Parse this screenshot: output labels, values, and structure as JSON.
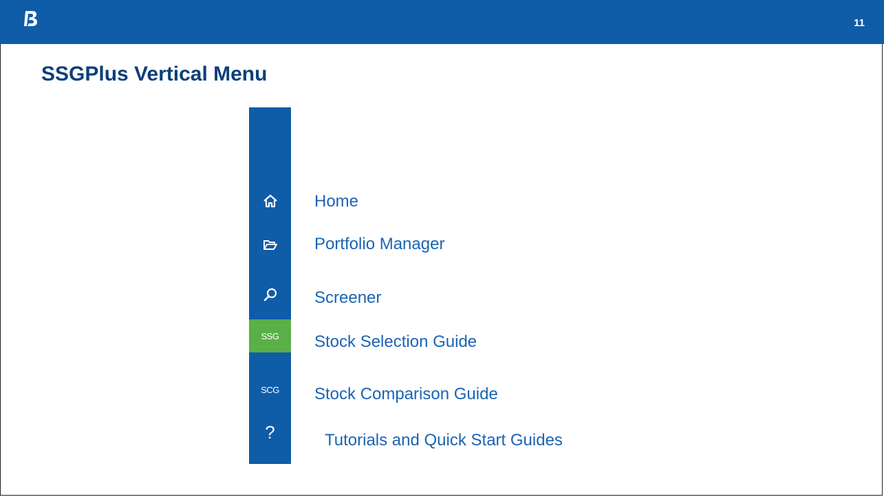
{
  "header": {
    "page_number": "11",
    "logo_icon": "stylized-b-logo-icon",
    "bar_color": "#0f5da9"
  },
  "slide": {
    "title": "SSGPlus Vertical Menu",
    "title_color": "#0d3f7a"
  },
  "sidebar": {
    "background": "#0f5ca8",
    "active_color": "#5aaf46",
    "items": [
      {
        "icon": "home-icon",
        "label": "Home"
      },
      {
        "icon": "folder-open-icon",
        "label": "Portfolio Manager"
      },
      {
        "icon": "search-icon",
        "label": "Screener"
      },
      {
        "icon": "ssg-text-icon",
        "icon_text": "SSG",
        "label": "Stock Selection Guide",
        "active": true
      },
      {
        "icon": "scg-text-icon",
        "icon_text": "SCG",
        "label": "Stock Comparison Guide"
      },
      {
        "icon": "help-icon",
        "icon_text": "?",
        "label": "Tutorials and Quick Start Guides"
      }
    ]
  }
}
